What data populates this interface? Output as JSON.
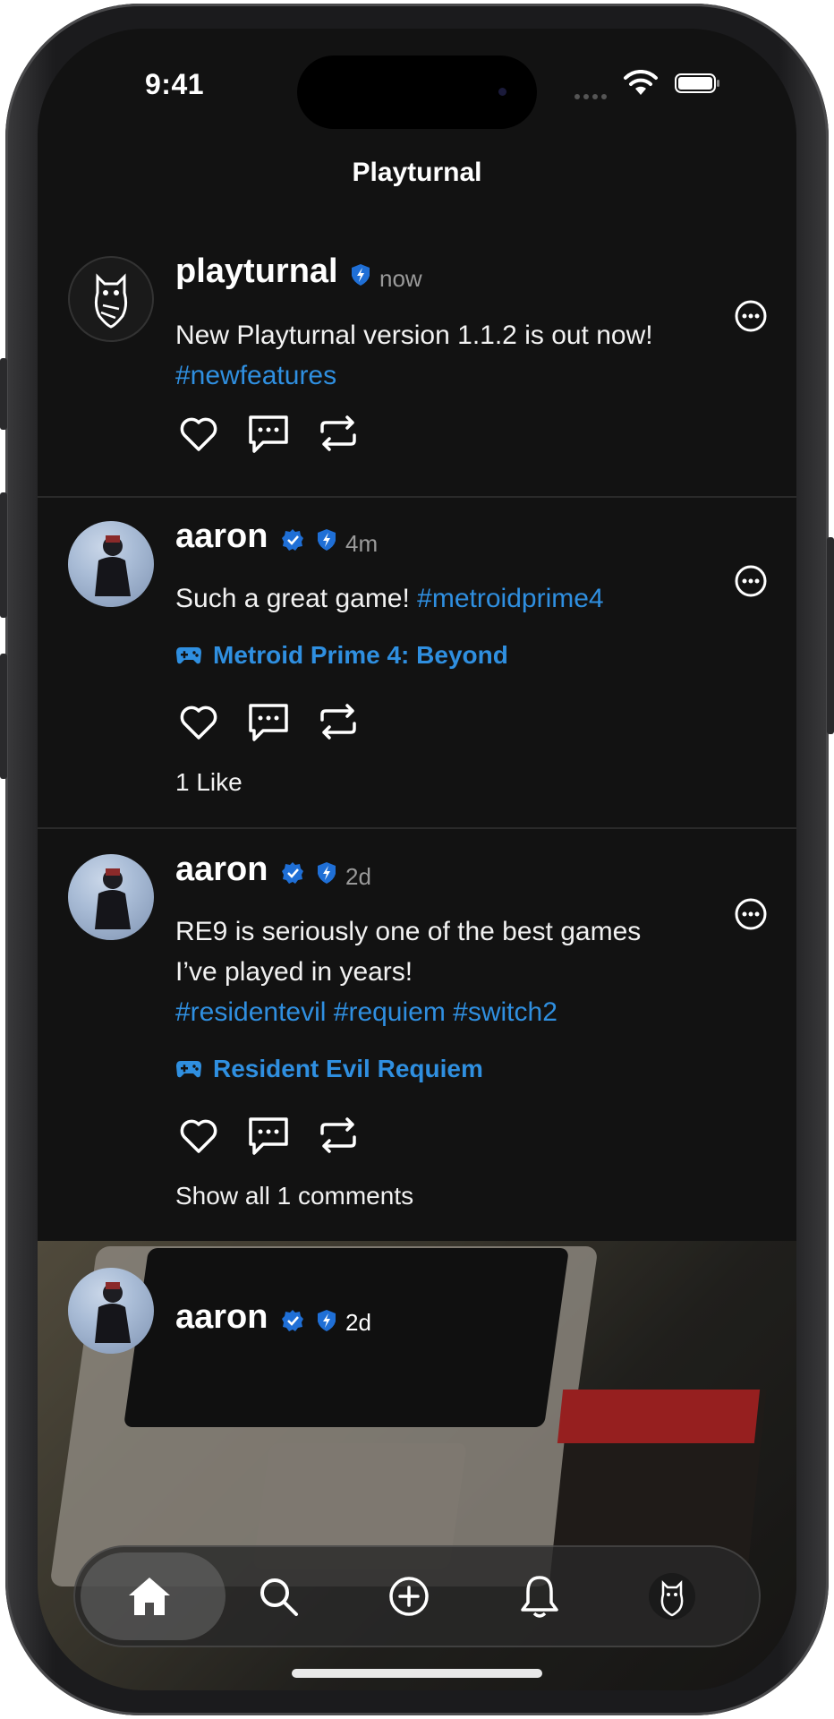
{
  "status_bar": {
    "time": "9:41"
  },
  "nav": {
    "title": "Playturnal"
  },
  "posts": [
    {
      "username": "playturnal",
      "time": "now",
      "text": "New Playturnal version 1.1.2 is out now!",
      "hashtags": "#newfeatures"
    },
    {
      "username": "aaron",
      "time": "4m",
      "text": "Such a great game!",
      "hashtags": "#metroidprime4",
      "game": "Metroid Prime 4: Beyond",
      "meta": "1 Like"
    },
    {
      "username": "aaron",
      "time": "2d",
      "text_line1": "RE9 is seriously one of the best games",
      "text_line2": "I’ve played in years!",
      "hashtags": "#residentevil #requiem #switch2",
      "game": "Resident Evil Requiem",
      "meta": "Show all 1 comments"
    },
    {
      "username": "aaron",
      "time": "2d"
    }
  ],
  "tabbar": {
    "icons": [
      "home-icon",
      "search-icon",
      "plus-circle-icon",
      "bell-icon",
      "profile-owl-icon"
    ]
  },
  "colors": {
    "accent": "#2f8fe0",
    "background": "#121212",
    "badge_blue": "#1f6fd6"
  }
}
